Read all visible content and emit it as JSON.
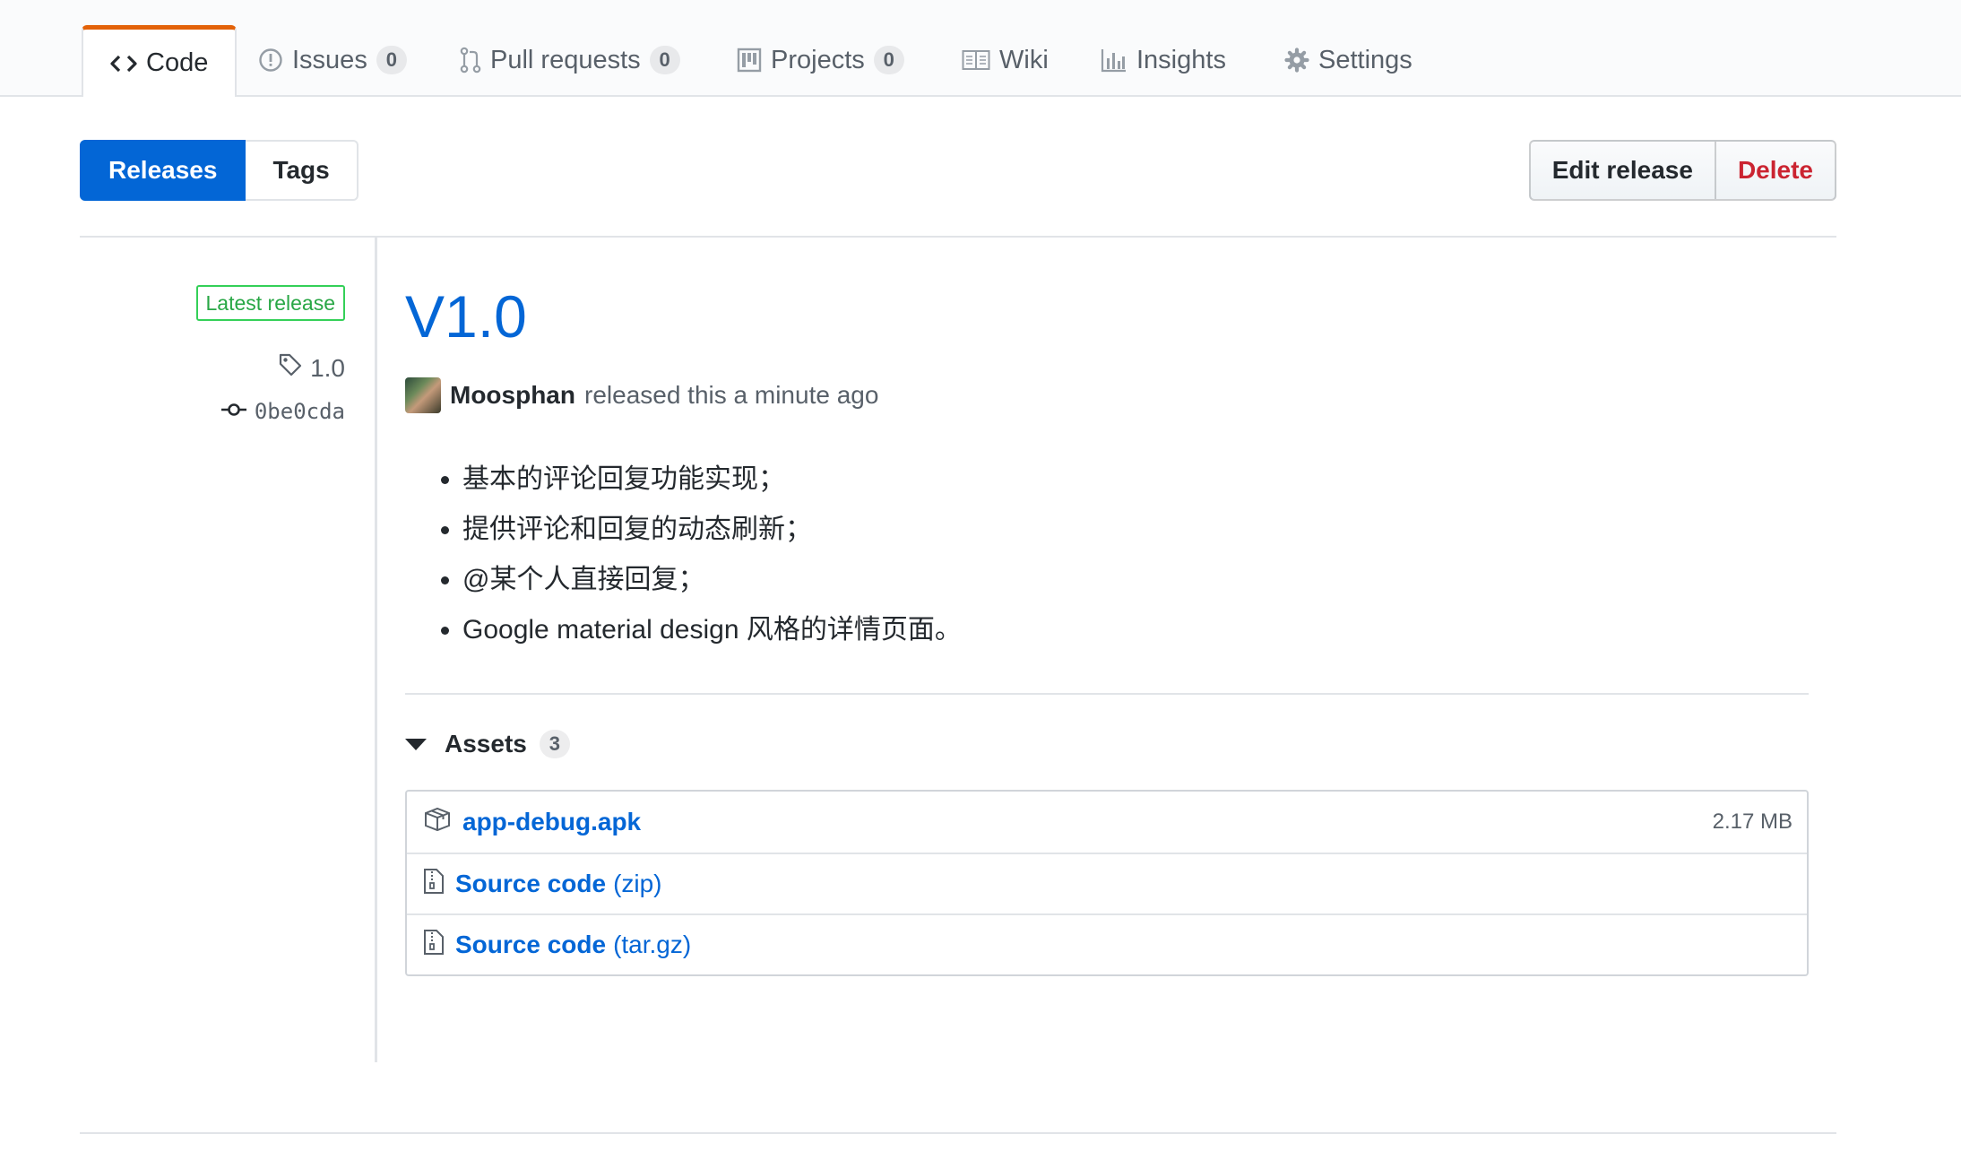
{
  "repo_nav": {
    "tabs": [
      {
        "label": "Code",
        "icon": "code-icon",
        "selected": true
      },
      {
        "label": "Issues",
        "icon": "issue-opened-icon",
        "count": "0"
      },
      {
        "label": "Pull requests",
        "icon": "git-pull-request-icon",
        "count": "0"
      },
      {
        "label": "Projects",
        "icon": "project-icon",
        "count": "0"
      },
      {
        "label": "Wiki",
        "icon": "book-icon"
      },
      {
        "label": "Insights",
        "icon": "graph-icon"
      },
      {
        "label": "Settings",
        "icon": "gear-icon"
      }
    ]
  },
  "subnav": {
    "releases_label": "Releases",
    "tags_label": "Tags"
  },
  "actions": {
    "edit_label": "Edit release",
    "delete_label": "Delete"
  },
  "release": {
    "latest_label": "Latest release",
    "tag": "1.0",
    "commit": "0be0cda",
    "title": "V1.0",
    "author": "Moosphan",
    "released_text": "released this a minute ago",
    "notes": [
      "基本的评论回复功能实现；",
      "提供评论和回复的动态刷新；",
      "@某个人直接回复；",
      "Google material design 风格的详情页面。"
    ]
  },
  "assets": {
    "label": "Assets",
    "count": "3",
    "items": [
      {
        "name": "app-debug.apk",
        "icon": "package-icon",
        "size": "2.17 MB"
      },
      {
        "name": "Source code",
        "suffix": "(zip)",
        "icon": "file-zip-icon"
      },
      {
        "name": "Source code",
        "suffix": "(tar.gz)",
        "icon": "file-zip-icon"
      }
    ]
  },
  "colors": {
    "accent": "#0366d6",
    "danger": "#cb2431",
    "success": "#28a745",
    "tab_highlight": "#e36209"
  }
}
